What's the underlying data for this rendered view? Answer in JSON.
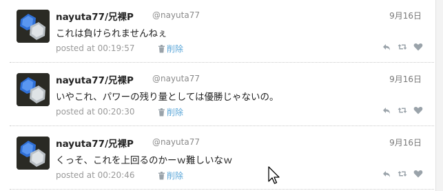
{
  "tweets": [
    {
      "name": "nayuta77/兄裸P",
      "handle": "@nayuta77",
      "date": "9月16日",
      "text": "これは負けられませんねぇ",
      "posted": "posted at 00:19:57",
      "delete_label": "削除"
    },
    {
      "name": "nayuta77/兄裸P",
      "handle": "@nayuta77",
      "date": "9月16日",
      "text": "いやこれ、パワーの残り量としては優勝じゃないの。",
      "posted": "posted at 00:20:30",
      "delete_label": "削除"
    },
    {
      "name": "nayuta77/兄裸P",
      "handle": "@nayuta77",
      "date": "9月16日",
      "text": "くっそ、これを上回るのかーｗ難しいなｗ",
      "posted": "posted at 00:20:46",
      "delete_label": "削除"
    }
  ],
  "icons": {
    "reply": "reply-icon",
    "retweet": "retweet-icon",
    "favorite": "heart-icon",
    "delete": "trash-icon"
  },
  "colors": {
    "link": "#5aa6d8",
    "meta": "#999999",
    "separator": "#c8c8c8"
  }
}
